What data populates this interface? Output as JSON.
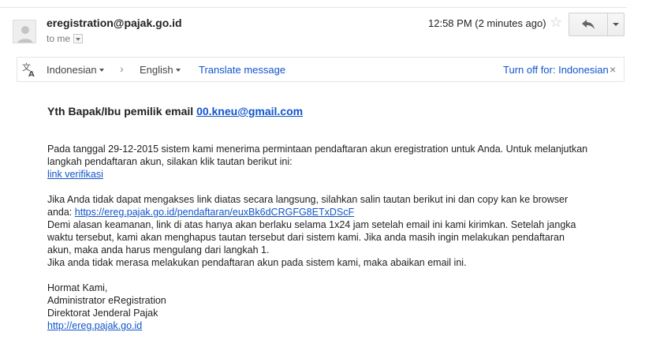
{
  "header": {
    "sender": "eregistration@pajak.go.id",
    "recipient": "to me",
    "timestamp": "12:58 PM (2 minutes ago)",
    "star_icon": "star-icon",
    "reply_icon": "reply-arrow-icon",
    "more_icon": "dropdown-caret-icon"
  },
  "translate_bar": {
    "source_language": "Indonesian",
    "target_language": "English",
    "arrow": "›",
    "translate_link": "Translate message",
    "turn_off": "Turn off for: Indonesian",
    "close": "×"
  },
  "email": {
    "greeting_text": "Yth Bapak/Ibu pemilik email",
    "greeting_email": "00.kneu@gmail.com",
    "p1_line1": "Pada tanggal 29-12-2015 sistem kami menerima permintaan pendaftaran akun eregistration untuk Anda. Untuk melanjutkan",
    "p1_line2": "langkah pendaftaran akun, silakan klik tautan berikut ini:",
    "link_verifikasi": "link verifikasi",
    "p2_line1": "Jika Anda tidak dapat mengakses link diatas secara langsung, silahkan salin tautan berikut ini dan copy kan ke browser",
    "p2_line2_prefix": "anda:",
    "p2_url": "https://ereg.pajak.go.id/pendaftaran/euxBk6dCRGFG8ETxDScF",
    "p3_line1": "Demi alasan keamanan, link di atas hanya akan berlaku selama 1x24 jam setelah email ini kami kirimkan. Setelah jangka",
    "p3_line2": "waktu tersebut, kami akan menghapus tautan tersebut dari sistem kami. Jika anda masih ingin melakukan pendaftaran",
    "p3_line3": "akun, maka anda harus mengulang dari langkah 1.",
    "p4_line1": "Jika anda tidak merasa melakukan pendaftaran akun pada sistem kami, maka abaikan email ini.",
    "sig1": "Hormat Kami,",
    "sig2": "Administrator eRegistration",
    "sig3": "Direktorat Jenderal Pajak",
    "sig_link": "http://ereg.pajak.go.id"
  },
  "colors": {
    "link": "#1155cc",
    "text": "#222222",
    "muted": "#777777"
  }
}
